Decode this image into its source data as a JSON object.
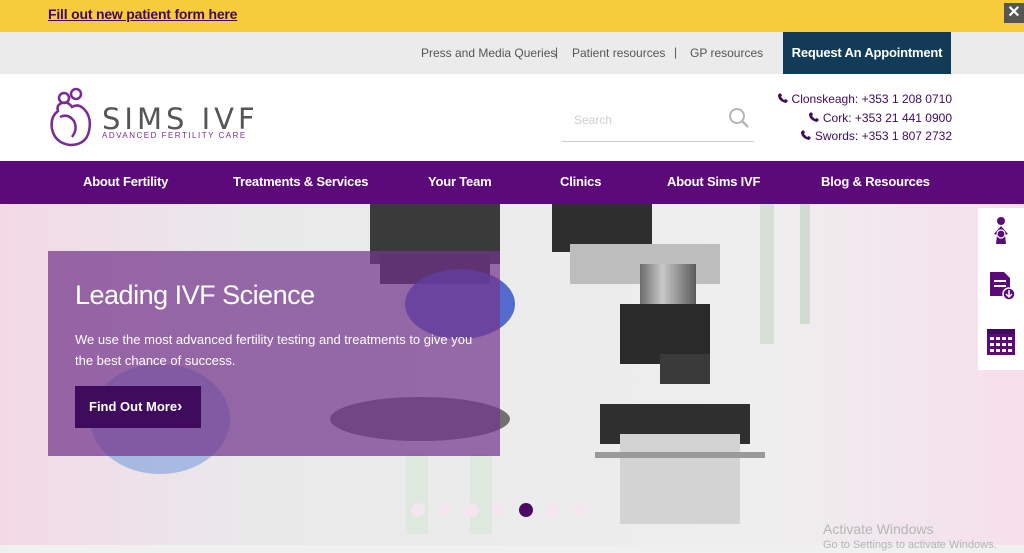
{
  "banner": {
    "link": "Fill out new patient form here",
    "close": "✕"
  },
  "utility": {
    "links": [
      "Press and Media Queries",
      "Patient resources",
      "GP resources"
    ],
    "separator": "|",
    "appointment_button": "Request An Appointment"
  },
  "header": {
    "logo_text": "SIMS IVF",
    "logo_tagline": "ADVANCED FERTILITY CARE",
    "search_placeholder": "Search",
    "phones": [
      "Clonskeagh: +353 1 208 0710",
      "Cork: +353 21 441 0900",
      "Swords: +353 1 807 2732"
    ]
  },
  "nav": {
    "items": [
      "About Fertility",
      "Treatments & Services",
      "Your Team",
      "Clinics",
      "About Sims IVF",
      "Blog & Resources"
    ]
  },
  "hero": {
    "title": "Leading IVF Science",
    "subtitle": "We use the most advanced fertility testing and treatments to give you the best chance of success.",
    "button": "Find Out More",
    "button_arrow": "›",
    "slide_count": 7,
    "active_slide": 5
  },
  "side_icons": [
    "woman-icon",
    "document-download-icon",
    "calendar-icon"
  ],
  "watermark": {
    "line1": "Activate Windows",
    "line2": "Go to Settings to activate Windows."
  },
  "colors": {
    "banner": "#f7cc3c",
    "brand_purple": "#5c0a7a",
    "dark_purple": "#3f0b5c",
    "appointment_blue": "#113b57"
  }
}
